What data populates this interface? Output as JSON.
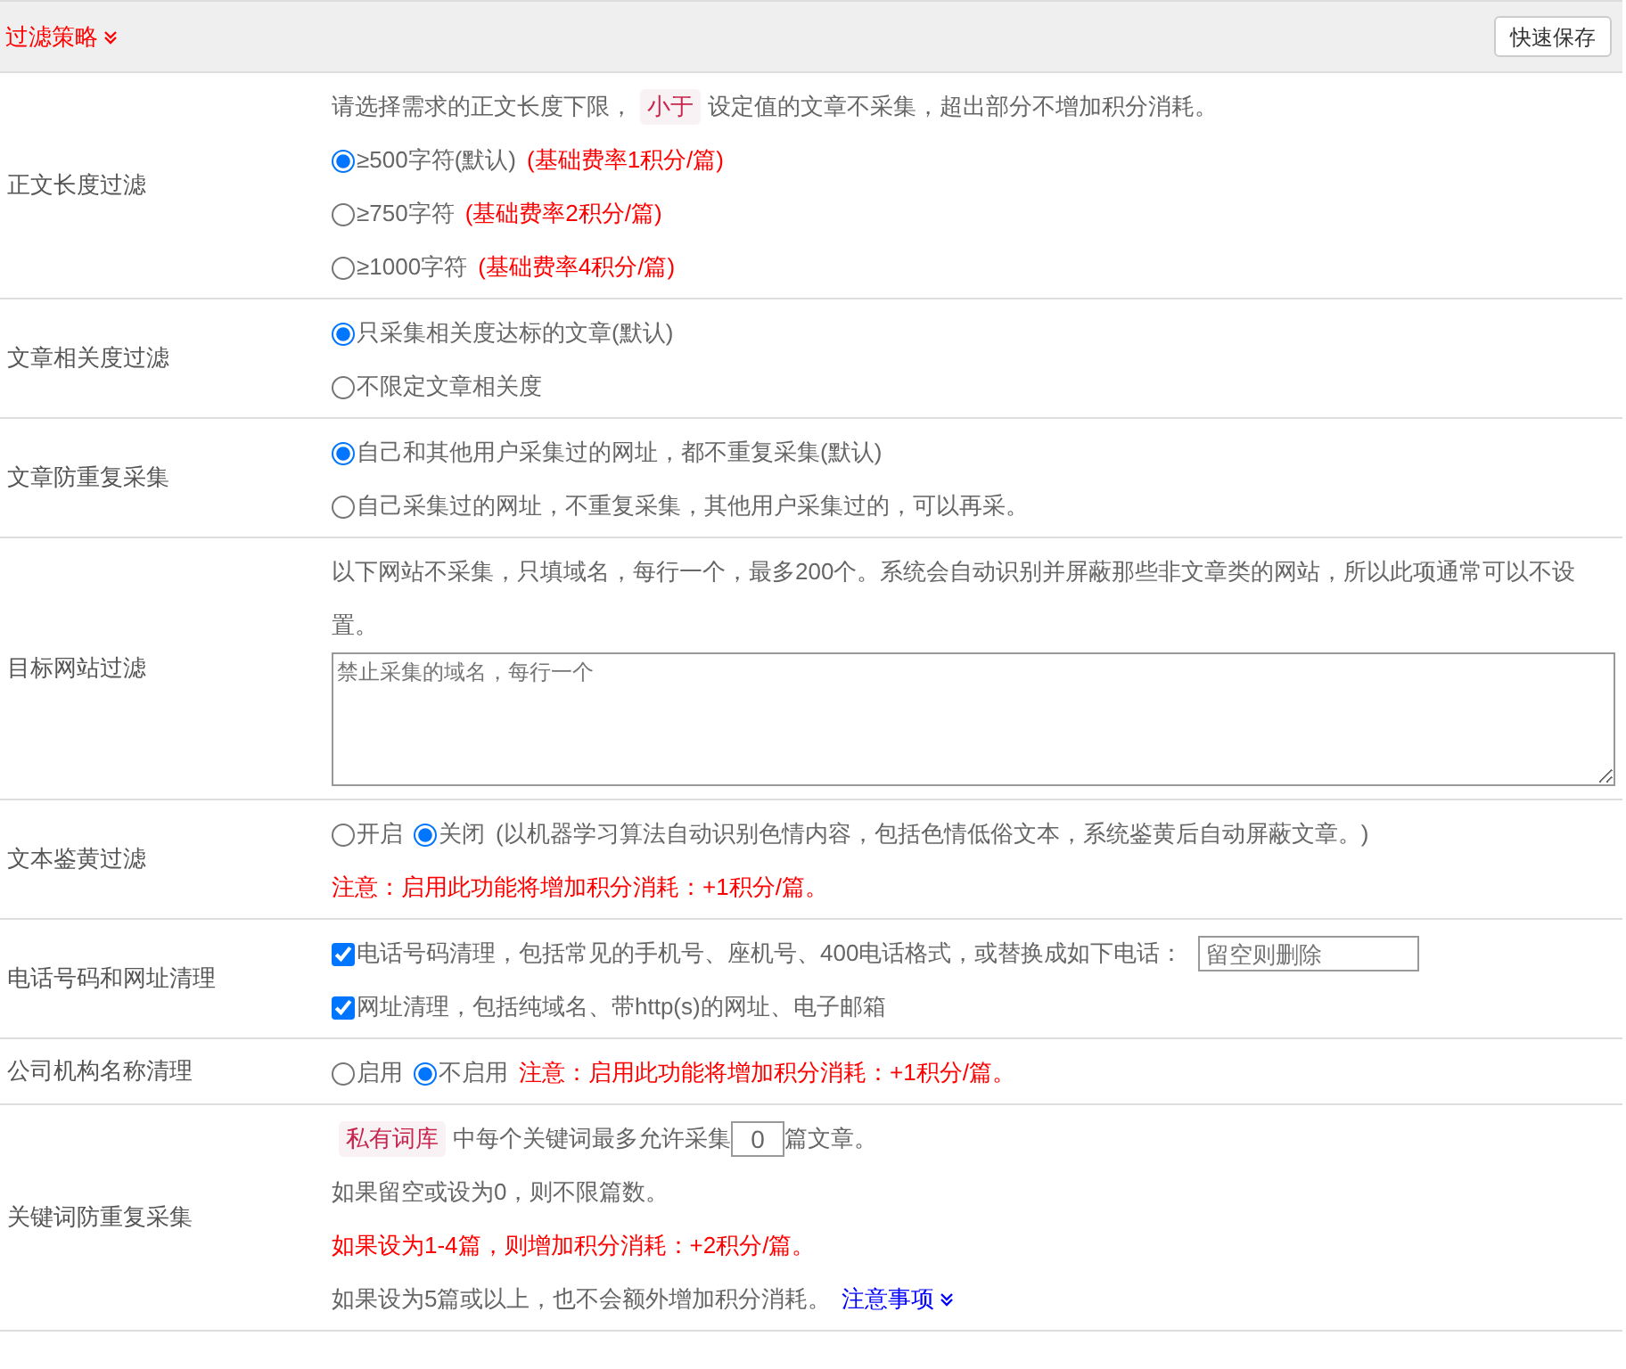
{
  "header": {
    "title": "过滤策略",
    "button": "快速保存"
  },
  "rows": [
    {
      "label": "正文长度过滤",
      "lines": [
        {
          "parts": [
            {
              "kind": "text",
              "text": "请选择需求的正文长度下限，"
            },
            {
              "kind": "tag",
              "text": "小于"
            },
            {
              "kind": "text",
              "text": "设定值的文章不采集，超出部分不增加积分消耗。"
            }
          ]
        },
        {
          "parts": [
            {
              "kind": "radio",
              "label": "≥500字符(默认)",
              "selected": true
            },
            {
              "kind": "warn",
              "text": "(基础费率1积分/篇)"
            }
          ]
        },
        {
          "parts": [
            {
              "kind": "radio",
              "label": "≥750字符",
              "selected": false
            },
            {
              "kind": "warn",
              "text": "(基础费率2积分/篇)"
            }
          ]
        },
        {
          "parts": [
            {
              "kind": "radio",
              "label": "≥1000字符",
              "selected": false
            },
            {
              "kind": "warn",
              "text": "(基础费率4积分/篇)"
            }
          ]
        }
      ]
    },
    {
      "label": "文章相关度过滤",
      "lines": [
        {
          "parts": [
            {
              "kind": "radio",
              "label": "只采集相关度达标的文章(默认)",
              "selected": true
            }
          ]
        },
        {
          "parts": [
            {
              "kind": "radio",
              "label": "不限定文章相关度",
              "selected": false
            }
          ]
        }
      ]
    },
    {
      "label": "文章防重复采集",
      "lines": [
        {
          "parts": [
            {
              "kind": "radio",
              "label": "自己和其他用户采集过的网址，都不重复采集(默认)",
              "selected": true
            }
          ]
        },
        {
          "parts": [
            {
              "kind": "radio",
              "label": "自己采集过的网址，不重复采集，其他用户采集过的，可以再采。",
              "selected": false
            }
          ]
        }
      ]
    },
    {
      "label": "目标网站过滤",
      "lines": [
        {
          "parts": [
            {
              "kind": "text",
              "text": "以下网站不采集，只填域名，每行一个，最多200个。系统会自动识别并屏蔽那些非文章类的网站，所以此项通常可以不设置。"
            }
          ]
        },
        {
          "parts": [
            {
              "kind": "textarea",
              "placeholder": "禁止采集的域名，每行一个"
            }
          ]
        }
      ]
    },
    {
      "label": "文本鉴黄过滤",
      "lines": [
        {
          "parts": [
            {
              "kind": "radio",
              "label": "开启",
              "selected": false
            },
            {
              "kind": "radio",
              "label": "关闭",
              "selected": true
            },
            {
              "kind": "text",
              "text": "(以机器学习算法自动识别色情内容，包括色情低俗文本，系统鉴黄后自动屏蔽文章。)"
            }
          ]
        },
        {
          "parts": [
            {
              "kind": "warn",
              "text": "注意：启用此功能将增加积分消耗：+1积分/篇。"
            }
          ]
        }
      ]
    },
    {
      "label": "电话号码和网址清理",
      "lines": [
        {
          "parts": [
            {
              "kind": "checkbox",
              "label": "电话号码清理，包括常见的手机号、座机号、400电话格式，或替换成如下电话：",
              "checked": true
            },
            {
              "kind": "input",
              "placeholder": "留空则删除"
            }
          ]
        },
        {
          "parts": [
            {
              "kind": "checkbox",
              "label": "网址清理，包括纯域名、带http(s)的网址、电子邮箱",
              "checked": true
            }
          ]
        }
      ]
    },
    {
      "label": "公司机构名称清理",
      "lines": [
        {
          "parts": [
            {
              "kind": "radio",
              "label": "启用",
              "selected": false
            },
            {
              "kind": "radio",
              "label": "不启用",
              "selected": true
            },
            {
              "kind": "warn",
              "text": "注意：启用此功能将增加积分消耗：+1积分/篇。"
            }
          ]
        }
      ]
    },
    {
      "label": "关键词防重复采集",
      "lines": [
        {
          "parts": [
            {
              "kind": "tag",
              "text": "私有词库"
            },
            {
              "kind": "text",
              "text": "中每个关键词最多允许采集"
            },
            {
              "kind": "number",
              "value": "0"
            },
            {
              "kind": "text",
              "text": "篇文章。"
            }
          ]
        },
        {
          "parts": [
            {
              "kind": "text",
              "text": "如果留空或设为0，则不限篇数。"
            }
          ]
        },
        {
          "parts": [
            {
              "kind": "warn",
              "text": "如果设为1-4篇，则增加积分消耗：+2积分/篇。"
            }
          ]
        },
        {
          "parts": [
            {
              "kind": "text",
              "text": "如果设为5篇或以上，也不会额外增加积分消耗。"
            },
            {
              "kind": "link",
              "text": "注意事项"
            }
          ]
        }
      ]
    }
  ]
}
